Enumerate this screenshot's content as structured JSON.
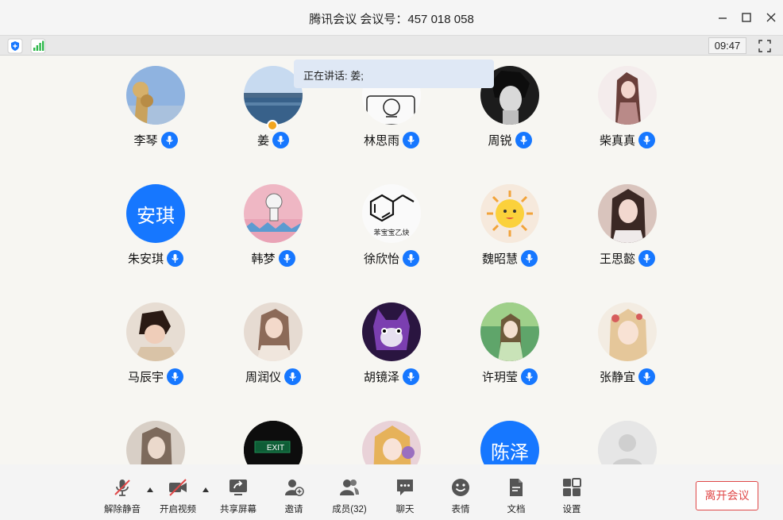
{
  "window": {
    "title": "腾讯会议 会议号：457 018 058"
  },
  "status": {
    "time": "09:47"
  },
  "speaking": {
    "text": "正在讲话: 姜;"
  },
  "participants": [
    {
      "name": "李琴"
    },
    {
      "name": "姜"
    },
    {
      "name": "林思雨"
    },
    {
      "name": "周锐"
    },
    {
      "name": "柴真真"
    },
    {
      "name": "朱安琪",
      "avatar_text": "安琪"
    },
    {
      "name": "韩梦"
    },
    {
      "name": "徐欣怡",
      "avatar_caption": "苯宝宝乙炔"
    },
    {
      "name": "魏昭慧"
    },
    {
      "name": "王思懿"
    },
    {
      "name": "马辰宇"
    },
    {
      "name": "周润仪"
    },
    {
      "name": "胡镜泽"
    },
    {
      "name": "许玥莹"
    },
    {
      "name": "张静宜"
    },
    {
      "avatar_caption": "EXIT"
    },
    {
      "avatar_text": "陈泽"
    }
  ],
  "toolbar": {
    "unmute": "解除静音",
    "start_video": "开启视频",
    "share_screen": "共享屏幕",
    "invite": "邀请",
    "members": "成员(32)",
    "chat": "聊天",
    "emoji": "表情",
    "docs": "文档",
    "settings": "设置",
    "leave": "离开会议"
  },
  "colors": {
    "accent": "#1677ff",
    "leave": "#e04848",
    "host_badge": "#f2a51e"
  }
}
